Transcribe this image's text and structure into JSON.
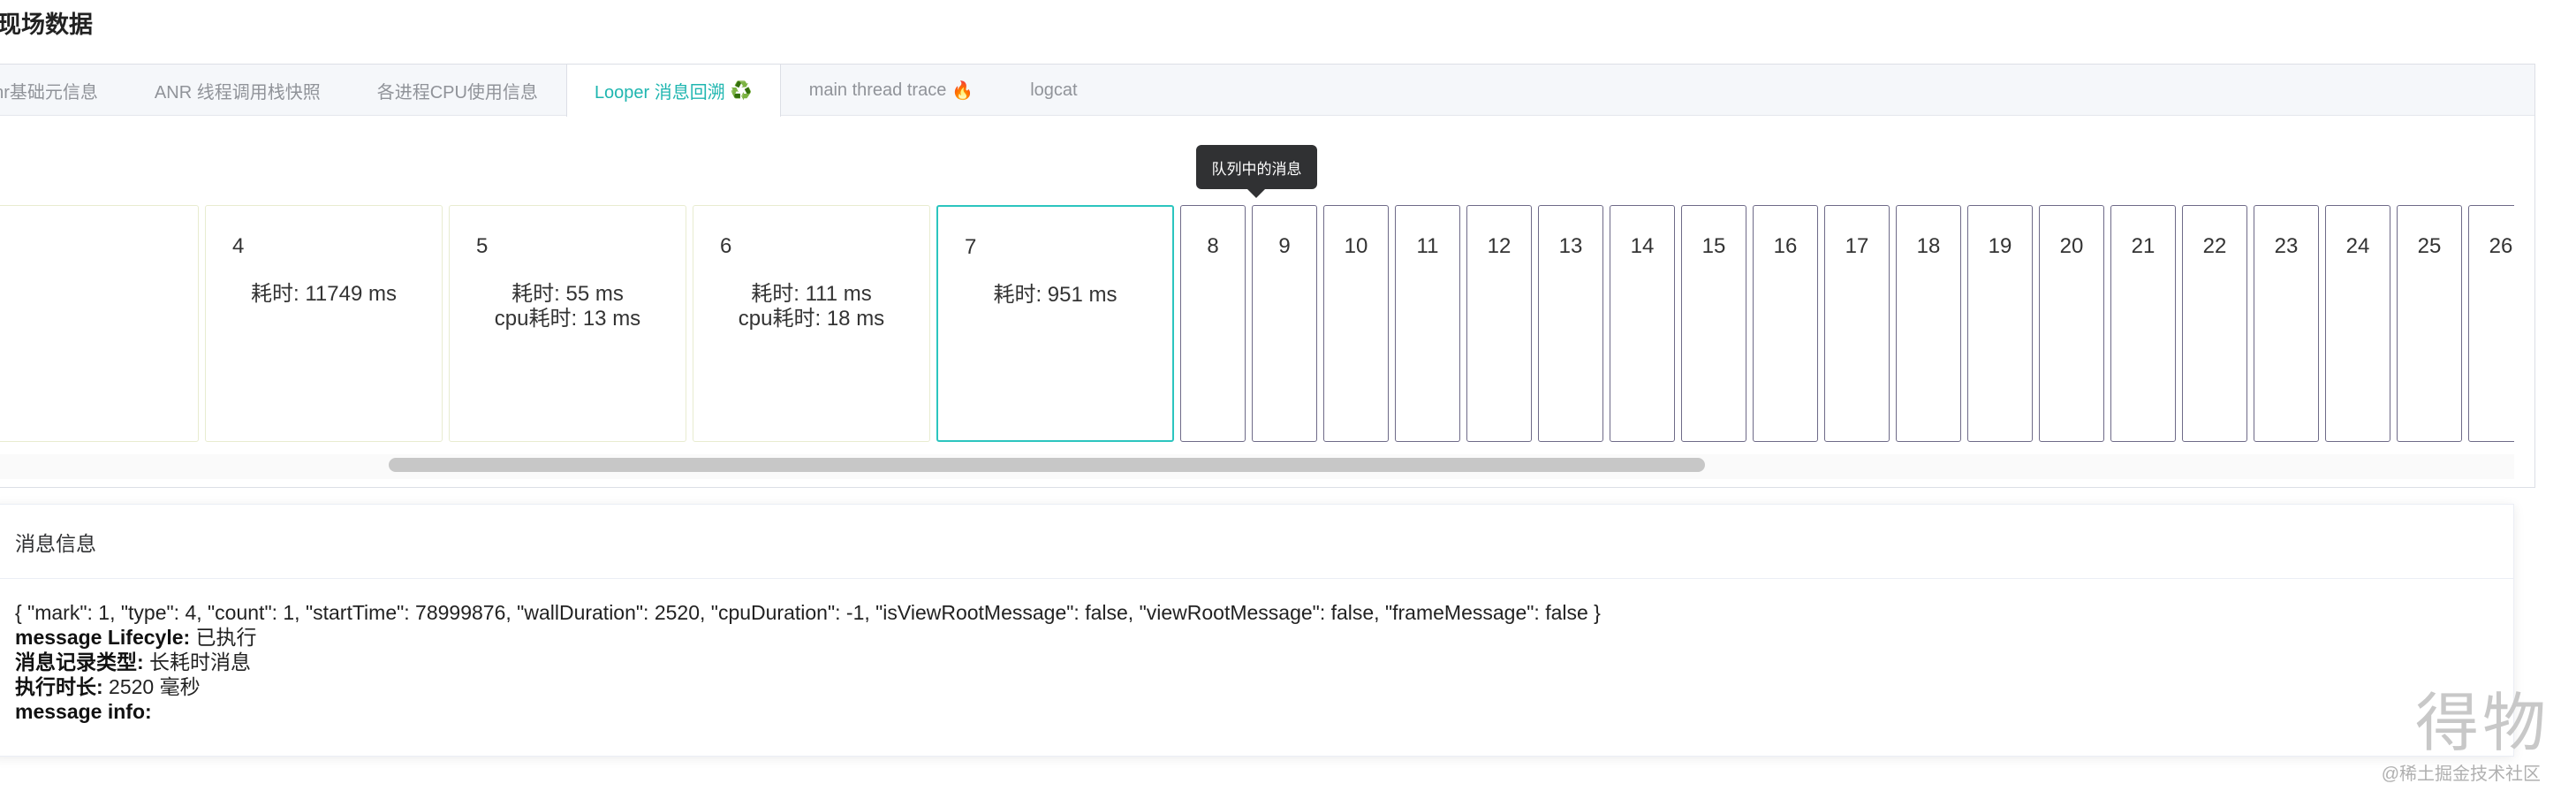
{
  "section_title": "细现场数据",
  "tabs": [
    {
      "label": "anr基础元信息",
      "icon": "",
      "active": false
    },
    {
      "label": "ANR 线程调用栈快照",
      "icon": "",
      "active": false
    },
    {
      "label": "各进程CPU使用信息",
      "icon": "",
      "active": false
    },
    {
      "label": "Looper 消息回溯",
      "icon": "♻️",
      "active": true
    },
    {
      "label": "main thread trace",
      "icon": "🔥",
      "active": false
    },
    {
      "label": "logcat",
      "icon": "",
      "active": false
    }
  ],
  "tooltip": "队列中的消息",
  "messages": [
    {
      "index": "",
      "lines": []
    },
    {
      "index": "4",
      "lines": [
        "耗时: 11749 ms"
      ]
    },
    {
      "index": "5",
      "lines": [
        "耗时: 55 ms",
        "cpu耗时: 13 ms"
      ]
    },
    {
      "index": "6",
      "lines": [
        "耗时: 111 ms",
        "cpu耗时: 18 ms"
      ]
    },
    {
      "index": "7",
      "lines": [
        "耗时: 951 ms"
      ]
    }
  ],
  "queued_messages": [
    "8",
    "9",
    "10",
    "11",
    "12",
    "13",
    "14",
    "15",
    "16",
    "17",
    "18",
    "19",
    "20",
    "21",
    "22",
    "23",
    "24",
    "25",
    "26"
  ],
  "info": {
    "header": "消息信息",
    "json_line": "{ \"mark\": 1, \"type\": 4, \"count\": 1, \"startTime\": 78999876, \"wallDuration\": 2520, \"cpuDuration\": -1, \"isViewRootMessage\": false, \"viewRootMessage\": false, \"frameMessage\": false }",
    "lifecycle_label": "message Lifecyle:",
    "lifecycle_value": " 已执行",
    "record_type_label": "消息记录类型:",
    "record_type_value": " 长耗时消息",
    "duration_label": "执行时长:",
    "duration_value": " 2520 毫秒",
    "message_info_label": "message info:"
  },
  "watermark": {
    "brand": "得物",
    "sub": "@稀土掘金技术社区"
  },
  "colors": {
    "accent": "#1fb6b0",
    "selected_border": "#2cc5bf",
    "queued_border": "#6e6a88"
  }
}
